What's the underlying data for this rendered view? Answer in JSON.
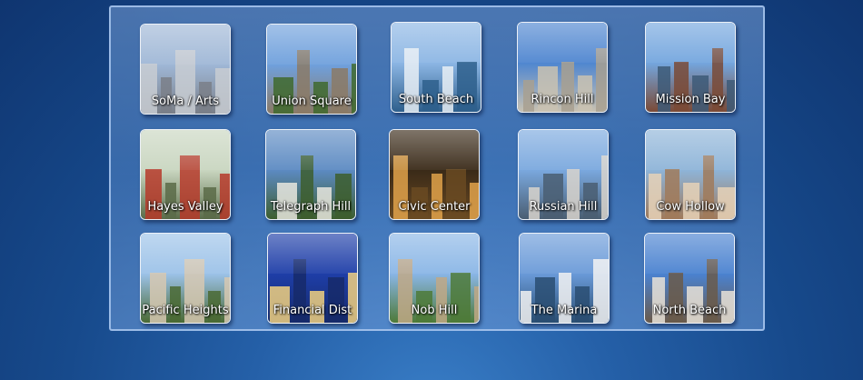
{
  "neighborhoods": [
    {
      "label": "SoMa / Arts",
      "sky": "#9fb7d6",
      "ground": "#7a7f88",
      "accent": "#c8ccd2"
    },
    {
      "label": "Union Square",
      "sky": "#6fa0dc",
      "ground": "#8b7a66",
      "accent": "#3f6a2e"
    },
    {
      "label": "South Beach",
      "sky": "#8cb6e4",
      "ground": "#2e5f8c",
      "accent": "#e8eef5"
    },
    {
      "label": "Rincon Hill",
      "sky": "#4f86d0",
      "ground": "#c9c2b2",
      "accent": "#a8a090"
    },
    {
      "label": "Mission Bay",
      "sky": "#74a6de",
      "ground": "#7a4a36",
      "accent": "#3d5a78"
    },
    {
      "label": "Hayes Valley",
      "sky": "#c9d6c0",
      "ground": "#5a6b48",
      "accent": "#b63a2a"
    },
    {
      "label": "Telegraph Hill",
      "sky": "#5c8ac2",
      "ground": "#3d5e2e",
      "accent": "#e8e6de"
    },
    {
      "label": "Civic Center",
      "sky": "#3a2a18",
      "ground": "#6a4a22",
      "accent": "#e0a24a"
    },
    {
      "label": "Russian Hill",
      "sky": "#7aa8de",
      "ground": "#4a5e72",
      "accent": "#d8d4cc"
    },
    {
      "label": "Cow Hollow",
      "sky": "#8eb4d8",
      "ground": "#a07a5a",
      "accent": "#e6d2b8"
    },
    {
      "label": "Pacific Heights",
      "sky": "#9cc2e8",
      "ground": "#4a6a34",
      "accent": "#d6c8b2"
    },
    {
      "label": "Financial Dist",
      "sky": "#1e3ea8",
      "ground": "#162a6a",
      "accent": "#f0d080"
    },
    {
      "label": "Nob Hill",
      "sky": "#8ab6e6",
      "ground": "#4e7a38",
      "accent": "#c0a886"
    },
    {
      "label": "The Marina",
      "sky": "#6a9ad8",
      "ground": "#2a4e72",
      "accent": "#f2f2f2"
    },
    {
      "label": "North Beach",
      "sky": "#4a82d0",
      "ground": "#6a5a4a",
      "accent": "#e8e2d8"
    }
  ]
}
